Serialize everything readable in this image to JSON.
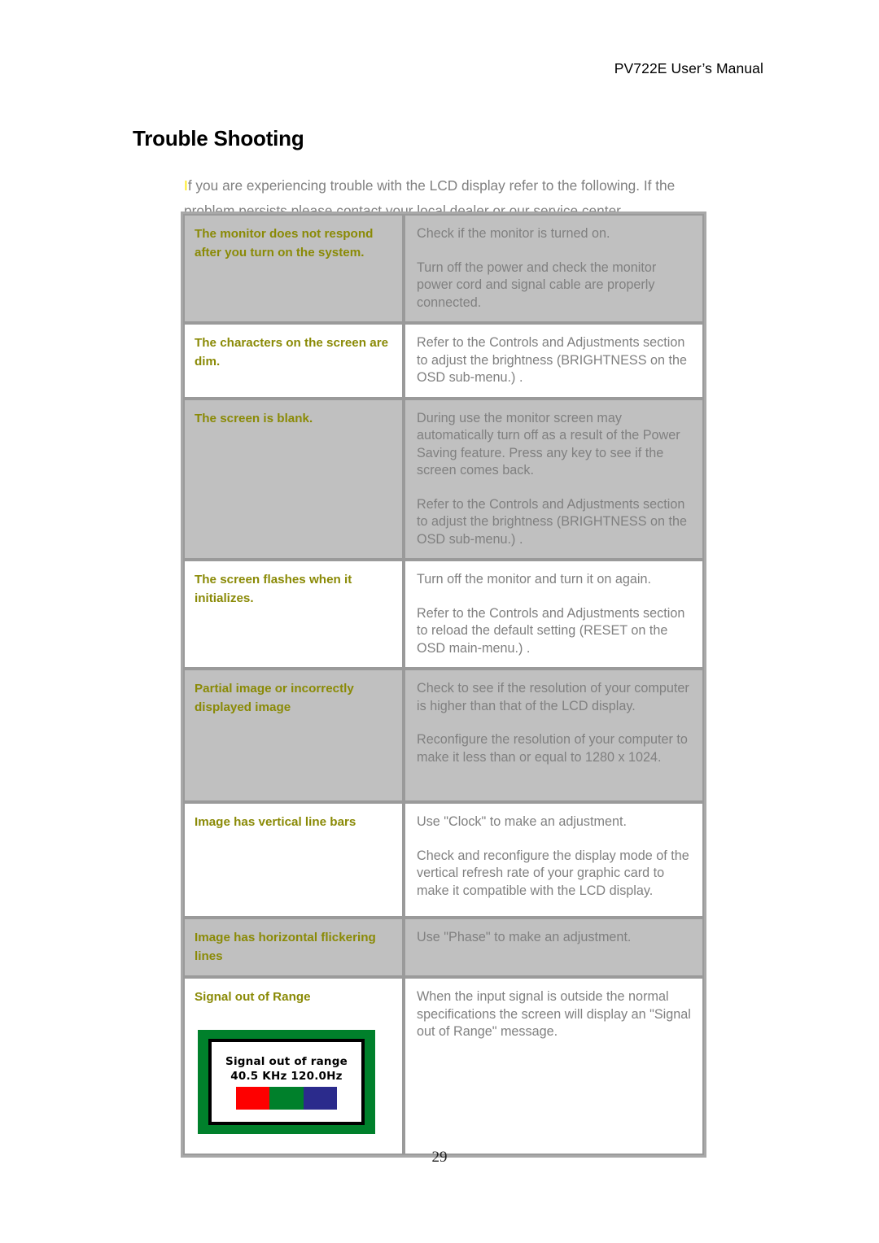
{
  "header": {
    "running_head": "PV722E User’s Manual"
  },
  "section": {
    "title": "Trouble Shooting",
    "intro_first_letter": "I",
    "intro_rest": "f you are experiencing trouble with the LCD display refer to the following. If the problem persists please contact your local dealer or our service center."
  },
  "table": {
    "rows": [
      {
        "symptom": "The monitor does not respond after you turn on the system.",
        "solutions": [
          "Check if the monitor is turned on.",
          "Turn off the power and check the monitor power cord and signal cable are properly connected."
        ],
        "shaded": true
      },
      {
        "symptom": "The characters on the screen are dim.",
        "solutions": [
          "Refer to the Controls and Adjustments section to adjust the brightness (BRIGHTNESS on the OSD sub-menu.) ."
        ],
        "shaded": false
      },
      {
        "symptom": "The screen is blank.",
        "solutions": [
          "During use the monitor screen may automatically turn off as a result of the Power Saving feature. Press any key to see if the screen comes back.",
          "Refer to the Controls and Adjustments section to adjust the brightness (BRIGHTNESS on the OSD sub-menu.) ."
        ],
        "shaded": true
      },
      {
        "symptom": "The screen flashes when it initializes.",
        "solutions": [
          "Turn off the monitor and turn it on again.",
          "Refer to the Controls and Adjustments section to reload the default setting (RESET on the OSD main-menu.) ."
        ],
        "shaded": false
      },
      {
        "symptom": "Partial image or incorrectly displayed image",
        "solutions": [
          "Check to see if the resolution of your computer is higher than that of the LCD display.",
          "Reconfigure the resolution of your computer to make it less than or equal to 1280 x 1024."
        ],
        "shaded": true
      },
      {
        "symptom": "Image has vertical line bars",
        "solutions": [
          "Use \"Clock\" to make an adjustment.",
          "Check and reconfigure the display mode of the vertical refresh rate of your graphic card to make it compatible with the LCD display."
        ],
        "shaded": false
      },
      {
        "symptom": "Image has horizontal flickering lines",
        "solutions": [
          "Use \"Phase\" to make an adjustment."
        ],
        "shaded": true
      },
      {
        "symptom": "Signal out of Range",
        "solutions": [
          "When the input signal is outside the normal specifications the screen will display an \"Signal out of Range\" message."
        ],
        "shaded": false
      }
    ]
  },
  "osd_graphic": {
    "message_line1": "Signal out of range",
    "message_line2": "40.5 KHz 120.0Hz",
    "bezel_color": "#00802b",
    "bar_colors": [
      "#fe0000",
      "#00802b",
      "#2b2b8c"
    ]
  },
  "footer": {
    "page_number": "29"
  },
  "colors": {
    "symptom_text": "#8a8a06",
    "body_text": "#808080",
    "shaded_row": "#c0c0c0",
    "highlight_letter": "#ffe800"
  }
}
